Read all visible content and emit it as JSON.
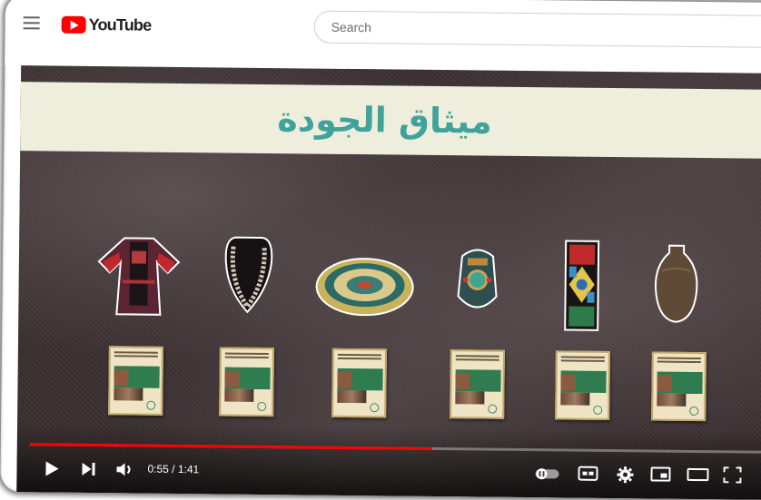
{
  "header": {
    "logo_text": "YouTube",
    "search_placeholder": "Search"
  },
  "video": {
    "banner_title": "ميثاق الجودة",
    "artifacts": [
      "dress",
      "necklace",
      "plate",
      "ornament",
      "stained-glass",
      "vase"
    ],
    "cover_count": 6
  },
  "player": {
    "time_display": "0:55 / 1:41",
    "progress": 0.545,
    "accent": "#ff0000"
  }
}
